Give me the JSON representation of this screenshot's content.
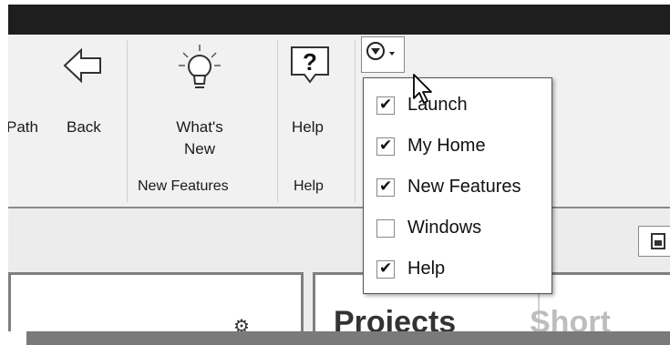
{
  "ribbon": {
    "buttons": [
      {
        "label": "Path",
        "icon": "path-icon"
      },
      {
        "label": "Back",
        "icon": "back-arrow-icon"
      },
      {
        "label_line1": "What's",
        "label_line2": "New",
        "icon": "lightbulb-icon"
      },
      {
        "label": "Help",
        "icon": "question-icon"
      }
    ],
    "groups": {
      "new_features": "New Features",
      "help": "Help"
    }
  },
  "qat_dropdown": {
    "icon": "customize-dropdown-icon",
    "items": [
      {
        "label": "Launch",
        "checked": true
      },
      {
        "label": "My Home",
        "checked": true
      },
      {
        "label": "New Features",
        "checked": true
      },
      {
        "label": "Windows",
        "checked": false
      },
      {
        "label": "Help",
        "checked": true
      }
    ]
  },
  "lower": {
    "tabs": [
      "Projects",
      "Short"
    ]
  },
  "colors": {
    "titlebar": "#1e1e1e",
    "ribbon_bg": "#f1f1f1",
    "panel_border": "#7f7f7f"
  }
}
